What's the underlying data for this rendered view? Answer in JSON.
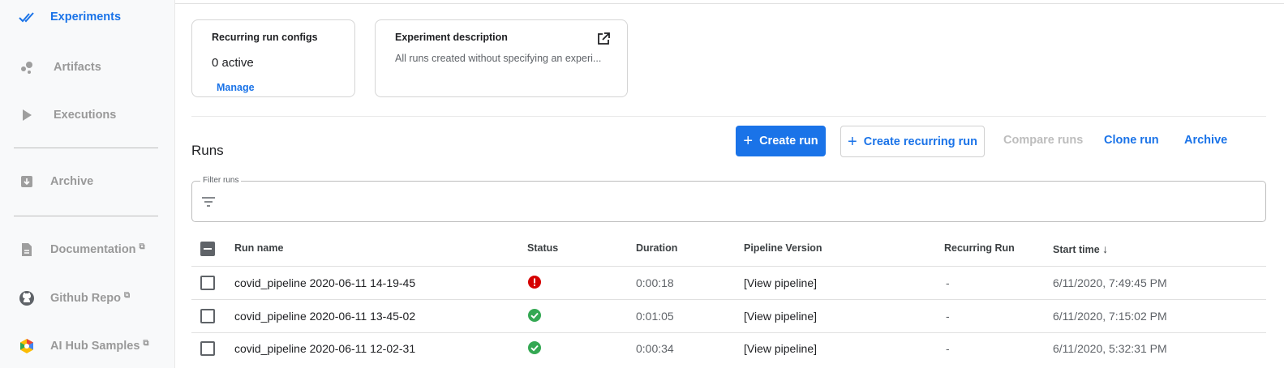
{
  "sidebar": {
    "items": [
      {
        "label": "Experiments",
        "icon": "double-check-icon",
        "active": true
      },
      {
        "label": "Artifacts",
        "icon": "artifacts-bubbles-icon"
      },
      {
        "label": "Executions",
        "icon": "play-icon"
      },
      {
        "label": "Archive",
        "icon": "archive-box-icon"
      },
      {
        "label": "Documentation",
        "icon": "document-icon",
        "external": true
      },
      {
        "label": "Github Repo",
        "icon": "github-icon",
        "external": true
      },
      {
        "label": "AI Hub Samples",
        "icon": "ai-hub-icon",
        "external": true
      }
    ]
  },
  "cards": {
    "recurring": {
      "title": "Recurring run configs",
      "value": "0 active",
      "link": "Manage"
    },
    "description": {
      "title": "Experiment description",
      "text": "All runs created without specifying an experi..."
    }
  },
  "runs": {
    "title": "Runs",
    "buttons": {
      "create_run": "Create run",
      "create_recurring": "Create recurring run",
      "compare": "Compare runs",
      "clone": "Clone run",
      "archive": "Archive"
    },
    "filter_label": "Filter runs",
    "columns": [
      "Run name",
      "Status",
      "Duration",
      "Pipeline Version",
      "Recurring Run",
      "Start time"
    ],
    "sort_indicator": "↓",
    "rows": [
      {
        "name": "covid_pipeline 2020-06-11 14-19-45",
        "status": "error",
        "duration": "0:00:18",
        "pipeline": "[View pipeline]",
        "recurring": "-",
        "start": "6/11/2020, 7:49:45 PM"
      },
      {
        "name": "covid_pipeline 2020-06-11 13-45-02",
        "status": "success",
        "duration": "0:01:05",
        "pipeline": "[View pipeline]",
        "recurring": "-",
        "start": "6/11/2020, 7:15:02 PM"
      },
      {
        "name": "covid_pipeline 2020-06-11 12-02-31",
        "status": "success",
        "duration": "0:00:34",
        "pipeline": "[View pipeline]",
        "recurring": "-",
        "start": "6/11/2020, 5:32:31 PM"
      }
    ]
  },
  "colors": {
    "accent": "#1a73e8",
    "error": "#d50000",
    "success": "#34a853"
  }
}
